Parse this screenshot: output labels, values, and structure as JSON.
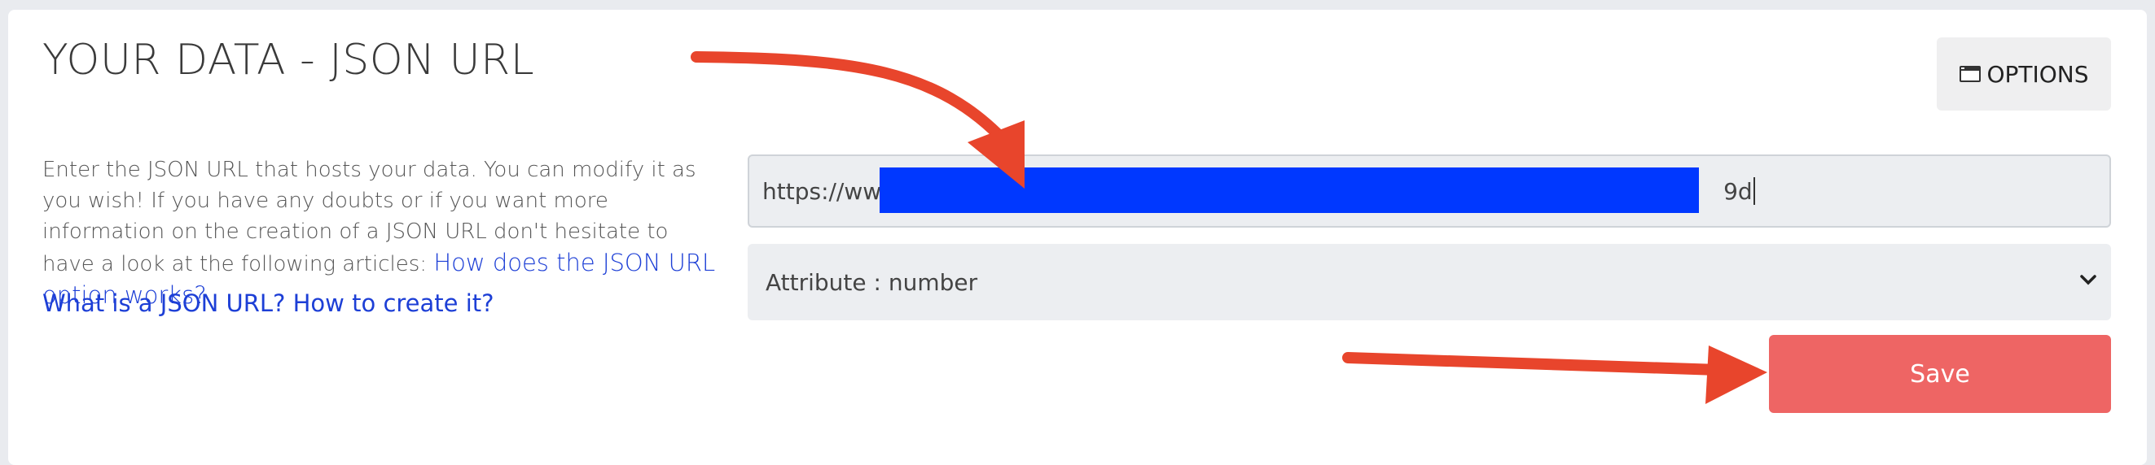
{
  "header": {
    "title": "YOUR DATA - JSON URL",
    "options_label": "OPTIONS",
    "options_icon": "window-icon"
  },
  "description": {
    "text": "Enter the JSON URL that hosts your data. You can modify it as you wish! If you have any doubts or if you want more information on the creation of a JSON URL don't hesitate to have a look at the following articles: ",
    "link1": "How does the JSON URL option works?",
    "link2": "What is a JSON URL? How to create it?"
  },
  "form": {
    "url_prefix": "https://www",
    "url_suffix": "9d",
    "attribute_select": "Attribute : number",
    "save_label": "Save"
  },
  "colors": {
    "accent_link": "#1d3fd6",
    "save_button": "#ee6564",
    "annotation_arrow": "#e8452c",
    "redaction": "#0038ff"
  }
}
